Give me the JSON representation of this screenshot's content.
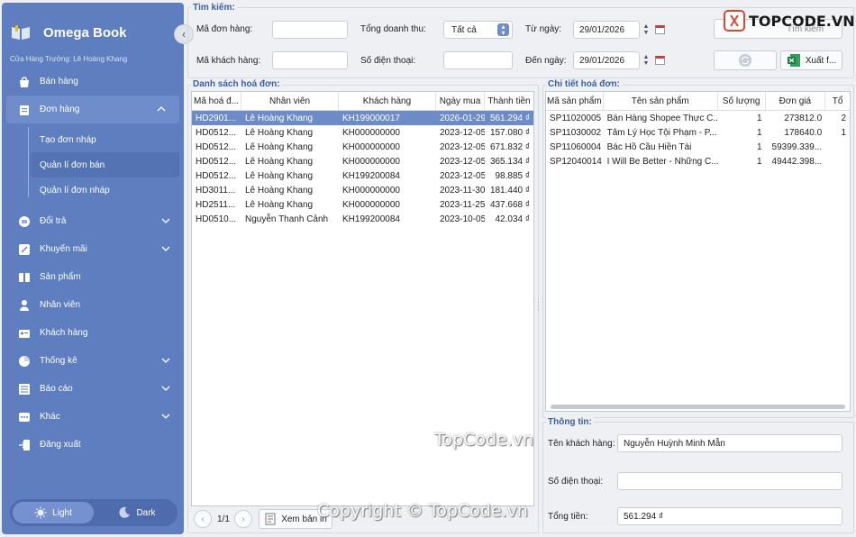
{
  "app": {
    "name": "Omega Book",
    "store": "Cửa Hàng Trưởng: Lê Hoàng Khang"
  },
  "sidebar": {
    "items": [
      {
        "label": "Bán hàng",
        "icon": "shop-icon"
      },
      {
        "label": "Đơn hàng",
        "icon": "clipboard-icon",
        "expanded": true
      },
      {
        "label": "Đổi trả",
        "icon": "exchange-icon"
      },
      {
        "label": "Khuyến mãi",
        "icon": "discount-icon"
      },
      {
        "label": "Sản phẩm",
        "icon": "box-icon"
      },
      {
        "label": "Nhân viên",
        "icon": "person-icon"
      },
      {
        "label": "Khách hàng",
        "icon": "id-card-icon"
      },
      {
        "label": "Thống kê",
        "icon": "pie-chart-icon"
      },
      {
        "label": "Báo cáo",
        "icon": "list-icon"
      },
      {
        "label": "Khác",
        "icon": "more-icon"
      },
      {
        "label": "Đăng xuất",
        "icon": "logout-icon"
      }
    ],
    "subitems": [
      "Tạo đơn nháp",
      "Quản lí đơn bán",
      "Quản lí đơn nháp"
    ],
    "theme": {
      "light": "Light",
      "dark": "Dark"
    }
  },
  "search": {
    "title": "Tìm kiếm:",
    "order_code_label": "Mã đơn hàng:",
    "customer_code_label": "Mã khách hàng:",
    "revenue_label": "Tổng doanh thu:",
    "revenue_value": "Tất cả",
    "phone_label": "Số điện thoại:",
    "from_label": "Từ ngày:",
    "from_value": "29/01/2026",
    "to_label": "Đến ngày:",
    "to_value": "29/01/2026",
    "search_button": "Tìm kiếm",
    "export_button": "Xuất f..."
  },
  "invoices": {
    "title": "Danh sách hoá đơn:",
    "columns": [
      "Mã hoá đ...",
      "Nhân viên",
      "Khách hàng",
      "Ngày mua",
      "Thành tiền"
    ],
    "rows": [
      [
        "HD2901...",
        "Lê Hoàng Khang",
        "KH199000017",
        "2026-01-29",
        "561.294 ₫"
      ],
      [
        "HD0512...",
        "Lê Hoàng Khang",
        "KH000000000",
        "2023-12-05",
        "157.080 ₫"
      ],
      [
        "HD0512...",
        "Lê Hoàng Khang",
        "KH000000000",
        "2023-12-05",
        "671.832 ₫"
      ],
      [
        "HD0512...",
        "Lê Hoàng Khang",
        "KH000000000",
        "2023-12-05",
        "365.134 ₫"
      ],
      [
        "HD0512...",
        "Lê Hoàng Khang",
        "KH199200084",
        "2023-12-05",
        "98.885 ₫"
      ],
      [
        "HD3011...",
        "Lê Hoàng Khang",
        "KH000000000",
        "2023-11-30",
        "181.440 ₫"
      ],
      [
        "HD2511...",
        "Lê Hoàng Khang",
        "KH000000000",
        "2023-11-25",
        "437.668 ₫"
      ],
      [
        "HD0510...",
        "Nguyễn Thanh Cảnh",
        "KH199200084",
        "2023-10-05",
        "42.034 ₫"
      ]
    ],
    "page": "1/1",
    "print_button": "Xem bản in"
  },
  "details": {
    "title": "Chi tiết hoá đơn:",
    "columns": [
      "Mã sản phẩm",
      "Tên sản phẩm",
      "Số lượng",
      "Đơn giá",
      "Tổ"
    ],
    "rows": [
      [
        "SP11020005",
        "Bán Hàng Shopee Thực C...",
        "1",
        "273812.0",
        "2"
      ],
      [
        "SP11030002",
        "Tâm Lý Học Tội Phạm - P...",
        "1",
        "178640.0",
        "1"
      ],
      [
        "SP11060004",
        "Bác Hồ Cầu Hiền Tài",
        "1",
        "59399.339...",
        ""
      ],
      [
        "SP12040014",
        "I Will Be Better - Những C...",
        "1",
        "49442.398...",
        ""
      ]
    ]
  },
  "info": {
    "title": "Thông tin:",
    "customer_label": "Tên khách hàng:",
    "customer_value": "Nguyễn Huỳnh Minh Mẫn",
    "phone_label": "Số điện thoại:",
    "phone_value": "",
    "total_label": "Tổng tiền:",
    "total_value": "561.294 ₫"
  },
  "watermark": {
    "center": "TopCode.vn",
    "bottom": "Copyright © TopCode.vn",
    "logo_text": "TOPCODE.VN"
  }
}
